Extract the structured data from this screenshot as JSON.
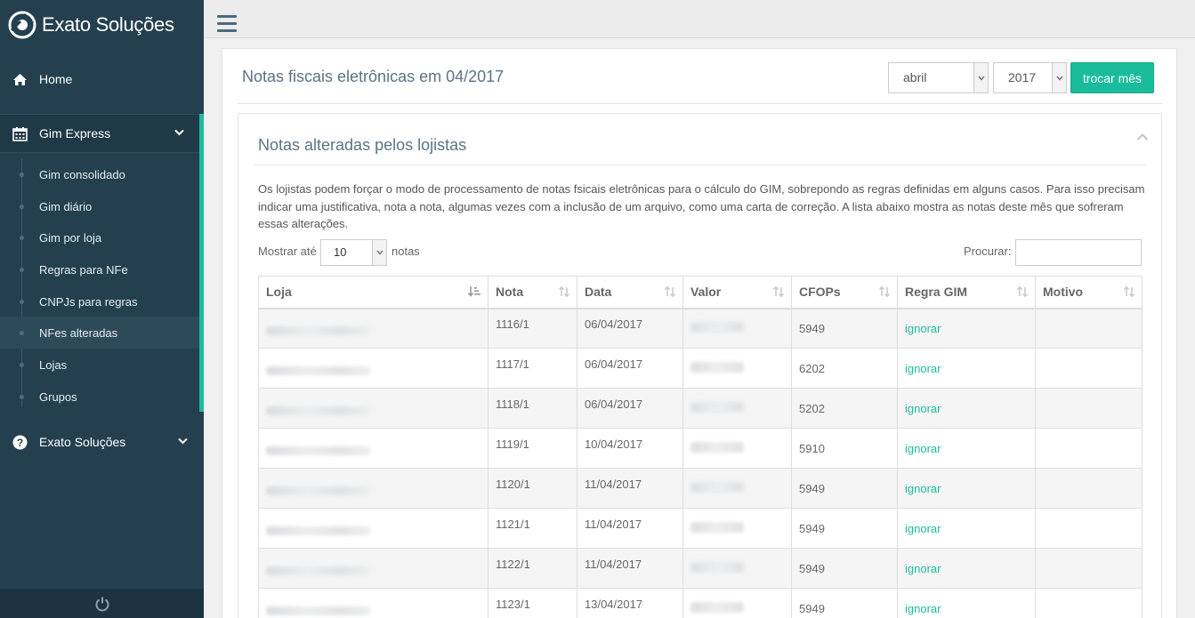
{
  "app": {
    "brand_name": "Exato Soluções"
  },
  "sidebar": {
    "home": {
      "label": "Home",
      "icon": "home-icon"
    },
    "gim_express": {
      "label": "Gim Express",
      "icon": "calendar-icon",
      "items": [
        {
          "label": "Gim consolidado",
          "active": false
        },
        {
          "label": "Gim diário",
          "active": false
        },
        {
          "label": "Gim por loja",
          "active": false
        },
        {
          "label": "Regras para NFe",
          "active": false
        },
        {
          "label": "CNPJs para regras",
          "active": false
        },
        {
          "label": "NFes alteradas",
          "active": true
        },
        {
          "label": "Lojas",
          "active": false
        },
        {
          "label": "Grupos",
          "active": false
        }
      ]
    },
    "exato": {
      "label": "Exato Soluções",
      "icon": "question-circle-icon"
    }
  },
  "page": {
    "title": "Notas fiscais eletrônicas em 04/2017",
    "month_value": "abril",
    "year_value": "2017",
    "swap_button": "trocar mês"
  },
  "card": {
    "title": "Notas alteradas pelos lojistas",
    "description": "Os lojistas podem forçar o modo de processamento de notas fsicais eletrônicas para o cálculo do GIM, sobrepondo as regras definidas em alguns casos. Para isso precisam indicar uma justificativa, nota a nota, algumas vezes com a inclusão de um arquivo, como uma carta de correção. A lista abaixo mostra as notas deste mês que sofreram essas alterações.",
    "length_label": "Mostrar até",
    "length_value": "10",
    "length_suffix": "notas",
    "search_label": "Procurar:",
    "search_value": ""
  },
  "table": {
    "columns": [
      "Loja",
      "Nota",
      "Data",
      "Valor",
      "CFOPs",
      "Regra GIM",
      "Motivo"
    ],
    "rows": [
      {
        "nota": "1116/1",
        "data": "06/04/2017",
        "cfops": "5949",
        "regra": "ignorar",
        "motivo": ""
      },
      {
        "nota": "1117/1",
        "data": "06/04/2017",
        "cfops": "6202",
        "regra": "ignorar",
        "motivo": ""
      },
      {
        "nota": "1118/1",
        "data": "06/04/2017",
        "cfops": "5202",
        "regra": "ignorar",
        "motivo": ""
      },
      {
        "nota": "1119/1",
        "data": "10/04/2017",
        "cfops": "5910",
        "regra": "ignorar",
        "motivo": ""
      },
      {
        "nota": "1120/1",
        "data": "11/04/2017",
        "cfops": "5949",
        "regra": "ignorar",
        "motivo": ""
      },
      {
        "nota": "1121/1",
        "data": "11/04/2017",
        "cfops": "5949",
        "regra": "ignorar",
        "motivo": ""
      },
      {
        "nota": "1122/1",
        "data": "11/04/2017",
        "cfops": "5949",
        "regra": "ignorar",
        "motivo": ""
      },
      {
        "nota": "1123/1",
        "data": "13/04/2017",
        "cfops": "5949",
        "regra": "ignorar",
        "motivo": ""
      }
    ]
  },
  "colors": {
    "accent": "#1abc9c",
    "sidebar_bg": "#24404f",
    "title": "#5b7385"
  }
}
